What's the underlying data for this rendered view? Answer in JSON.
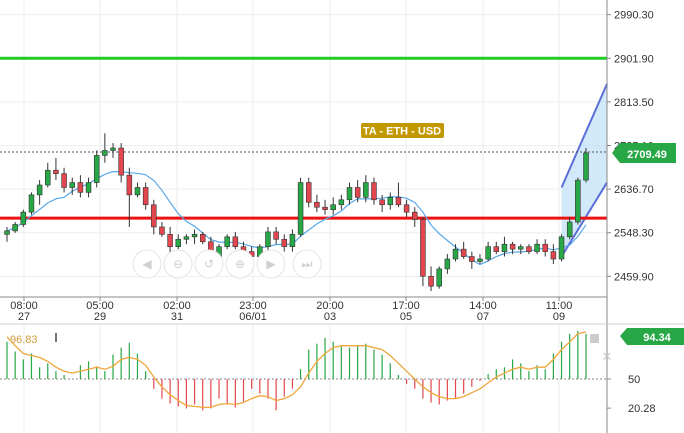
{
  "chart_data": [
    {
      "type": "candlestick",
      "title": "TA - ETH - USD",
      "y_ticks": [
        "2990.30",
        "2901.90",
        "2813.50",
        "2725.10",
        "2636.70",
        "2548.30",
        "2459.90"
      ],
      "ylim": [
        2418,
        3020
      ],
      "x_tick_labels": [
        {
          "time": "08:00",
          "date": "27"
        },
        {
          "time": "05:00",
          "date": "29"
        },
        {
          "time": "02:00",
          "date": "31"
        },
        {
          "time": "23:00",
          "date": "06/01"
        },
        {
          "time": "20:00",
          "date": "03"
        },
        {
          "time": "17:00",
          "date": "05"
        },
        {
          "time": "14:00",
          "date": "07"
        },
        {
          "time": "11:00",
          "date": "09"
        }
      ],
      "last_price": "2709.49",
      "horizontal_levels": [
        {
          "value": 2901.9,
          "color": "#22cc22"
        },
        {
          "value": 2578.0,
          "color": "#ee1111"
        }
      ],
      "dotted_levels": [
        2712,
        2418
      ],
      "candles": [
        [
          2545,
          2560,
          2530,
          2552
        ],
        [
          2552,
          2570,
          2548,
          2565
        ],
        [
          2565,
          2595,
          2560,
          2590
        ],
        [
          2590,
          2630,
          2585,
          2625
        ],
        [
          2625,
          2655,
          2605,
          2645
        ],
        [
          2645,
          2690,
          2640,
          2675
        ],
        [
          2675,
          2700,
          2655,
          2668
        ],
        [
          2668,
          2680,
          2630,
          2640
        ],
        [
          2640,
          2660,
          2625,
          2650
        ],
        [
          2650,
          2665,
          2620,
          2630
        ],
        [
          2630,
          2660,
          2620,
          2650
        ],
        [
          2650,
          2715,
          2640,
          2705
        ],
        [
          2705,
          2750,
          2690,
          2715
        ],
        [
          2715,
          2730,
          2700,
          2720
        ],
        [
          2720,
          2730,
          2650,
          2665
        ],
        [
          2665,
          2680,
          2560,
          2625
        ],
        [
          2625,
          2650,
          2620,
          2640
        ],
        [
          2640,
          2650,
          2595,
          2605
        ],
        [
          2605,
          2615,
          2545,
          2560
        ],
        [
          2560,
          2570,
          2540,
          2545
        ],
        [
          2545,
          2560,
          2505,
          2520
        ],
        [
          2520,
          2545,
          2515,
          2535
        ],
        [
          2535,
          2545,
          2525,
          2540
        ],
        [
          2540,
          2555,
          2525,
          2545
        ],
        [
          2545,
          2550,
          2525,
          2530
        ],
        [
          2530,
          2540,
          2490,
          2500
        ],
        [
          2500,
          2525,
          2495,
          2520
        ],
        [
          2520,
          2545,
          2515,
          2540
        ],
        [
          2540,
          2550,
          2515,
          2520
        ],
        [
          2520,
          2530,
          2500,
          2510
        ],
        [
          2510,
          2520,
          2495,
          2500
        ],
        [
          2500,
          2525,
          2490,
          2520
        ],
        [
          2520,
          2560,
          2510,
          2550
        ],
        [
          2550,
          2560,
          2525,
          2535
        ],
        [
          2535,
          2545,
          2510,
          2520
        ],
        [
          2520,
          2555,
          2510,
          2545
        ],
        [
          2545,
          2660,
          2540,
          2650
        ],
        [
          2650,
          2660,
          2600,
          2610
        ],
        [
          2610,
          2625,
          2590,
          2600
        ],
        [
          2600,
          2615,
          2585,
          2595
        ],
        [
          2595,
          2620,
          2585,
          2605
        ],
        [
          2605,
          2625,
          2595,
          2615
        ],
        [
          2615,
          2650,
          2605,
          2640
        ],
        [
          2640,
          2655,
          2610,
          2620
        ],
        [
          2620,
          2665,
          2610,
          2650
        ],
        [
          2650,
          2660,
          2605,
          2615
        ],
        [
          2615,
          2625,
          2590,
          2605
        ],
        [
          2605,
          2630,
          2595,
          2620
        ],
        [
          2620,
          2650,
          2600,
          2605
        ],
        [
          2605,
          2615,
          2580,
          2590
        ],
        [
          2590,
          2600,
          2560,
          2575
        ],
        [
          2575,
          2580,
          2440,
          2460
        ],
        [
          2460,
          2480,
          2430,
          2440
        ],
        [
          2440,
          2480,
          2435,
          2475
        ],
        [
          2475,
          2505,
          2465,
          2495
        ],
        [
          2495,
          2525,
          2490,
          2515
        ],
        [
          2515,
          2530,
          2495,
          2500
        ],
        [
          2500,
          2510,
          2475,
          2490
        ],
        [
          2490,
          2505,
          2485,
          2495
        ],
        [
          2495,
          2530,
          2490,
          2520
        ],
        [
          2520,
          2530,
          2505,
          2510
        ],
        [
          2510,
          2540,
          2500,
          2525
        ],
        [
          2525,
          2530,
          2505,
          2515
        ],
        [
          2515,
          2525,
          2505,
          2520
        ],
        [
          2520,
          2525,
          2505,
          2510
        ],
        [
          2510,
          2535,
          2505,
          2525
        ],
        [
          2525,
          2535,
          2500,
          2510
        ],
        [
          2510,
          2525,
          2485,
          2495
        ],
        [
          2495,
          2545,
          2490,
          2540
        ],
        [
          2540,
          2580,
          2535,
          2570
        ],
        [
          2570,
          2660,
          2565,
          2655
        ],
        [
          2655,
          2720,
          2650,
          2710
        ]
      ]
    },
    {
      "type": "bar",
      "series_label": "96.83",
      "current_value": "94.34",
      "y_ticks": [
        "50",
        "20.28"
      ],
      "ylim": [
        0,
        100
      ],
      "values": [
        88,
        78,
        70,
        76,
        62,
        66,
        58,
        54,
        50,
        64,
        68,
        63,
        58,
        75,
        82,
        87,
        76,
        58,
        40,
        30,
        25,
        22,
        20,
        24,
        18,
        20,
        30,
        24,
        21,
        27,
        40,
        35,
        30,
        18,
        32,
        40,
        60,
        80,
        86,
        92,
        88,
        84,
        82,
        84,
        86,
        80,
        75,
        66,
        54,
        45,
        40,
        30,
        26,
        24,
        28,
        30,
        35,
        42,
        48,
        55,
        60,
        62,
        70,
        66,
        58,
        64,
        60,
        76,
        88,
        96,
        99,
        96
      ],
      "oscillator_line": [
        93,
        84,
        76,
        74,
        72,
        68,
        62,
        58,
        56,
        58,
        60,
        62,
        60,
        63,
        70,
        72,
        70,
        64,
        52,
        42,
        34,
        28,
        23,
        22,
        21,
        21,
        24,
        25,
        24,
        26,
        30,
        33,
        32,
        28,
        30,
        34,
        42,
        56,
        68,
        76,
        82,
        84,
        84,
        84,
        84,
        82,
        80,
        74,
        66,
        58,
        50,
        42,
        36,
        32,
        30,
        30,
        32,
        36,
        40,
        46,
        52,
        56,
        60,
        62,
        60,
        62,
        62,
        70,
        80,
        88,
        96,
        98
      ]
    }
  ]
}
